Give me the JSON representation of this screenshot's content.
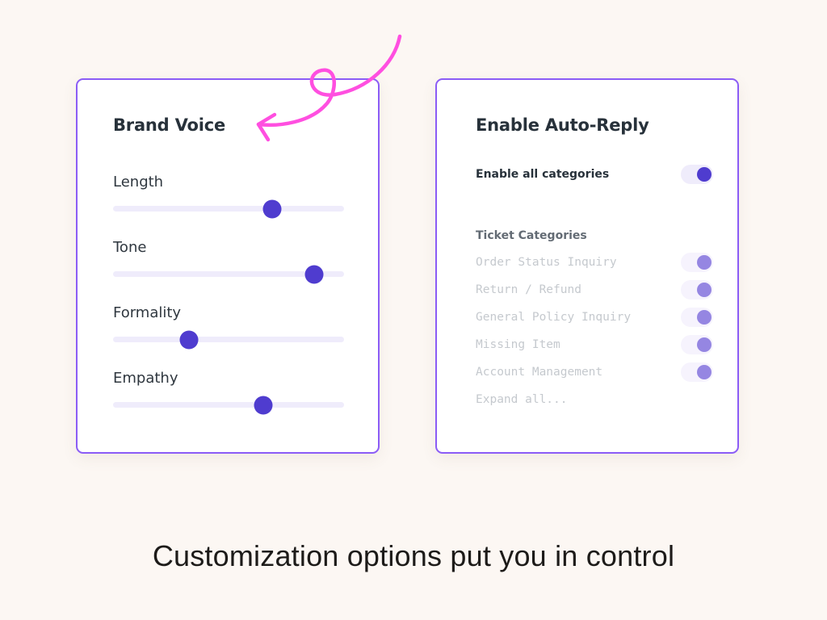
{
  "colors": {
    "background": "#fcf7f3",
    "card_border": "#8b5cf6",
    "accent": "#4f3ccf",
    "accent_muted": "#9586e2",
    "track": "#efecfb",
    "doodle": "#ff4fe0"
  },
  "brand_voice": {
    "title": "Brand Voice",
    "sliders": [
      {
        "label": "Length",
        "value": 0.69
      },
      {
        "label": "Tone",
        "value": 0.87
      },
      {
        "label": "Formality",
        "value": 0.33
      },
      {
        "label": "Empathy",
        "value": 0.65
      }
    ]
  },
  "auto_reply": {
    "title": "Enable Auto-Reply",
    "master_toggle": {
      "label": "Enable all categories",
      "on": true
    },
    "section_label": "Ticket Categories",
    "categories": [
      {
        "label": "Order Status Inquiry",
        "on": true
      },
      {
        "label": "Return / Refund",
        "on": true
      },
      {
        "label": "General Policy Inquiry",
        "on": true
      },
      {
        "label": "Missing Item",
        "on": true
      },
      {
        "label": "Account Management",
        "on": true
      }
    ],
    "expand_label": "Expand all..."
  },
  "caption": "Customization options put you in control",
  "annotation": {
    "icon": "curly-arrow-icon"
  }
}
